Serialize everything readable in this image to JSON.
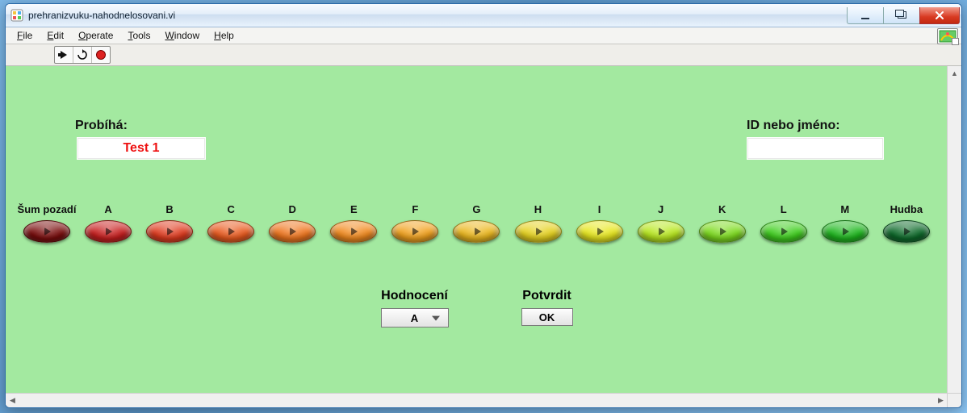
{
  "window": {
    "title": "prehranizvuku-nahodnelosovani.vi"
  },
  "menu": {
    "items": [
      {
        "label": "File",
        "hotkey": "F"
      },
      {
        "label": "Edit",
        "hotkey": "E"
      },
      {
        "label": "Operate",
        "hotkey": "O"
      },
      {
        "label": "Tools",
        "hotkey": "T"
      },
      {
        "label": "Window",
        "hotkey": "W"
      },
      {
        "label": "Help",
        "hotkey": "H"
      }
    ]
  },
  "toolbar": {
    "buttons": [
      "run-arrow",
      "run-continuous",
      "abort"
    ]
  },
  "labels": {
    "running": "Probíhá:",
    "id_name": "ID nebo jméno:",
    "rating": "Hodnocení",
    "confirm": "Potvrdit"
  },
  "running_value": "Test 1",
  "id_value": "",
  "ovals": [
    {
      "label": "Šum pozadí",
      "color": "#7a0d0d"
    },
    {
      "label": "A",
      "color": "#c81e1e"
    },
    {
      "label": "B",
      "color": "#e03a1e"
    },
    {
      "label": "C",
      "color": "#ea5a1e"
    },
    {
      "label": "D",
      "color": "#f0761e"
    },
    {
      "label": "E",
      "color": "#f28a1e"
    },
    {
      "label": "F",
      "color": "#f2a21e"
    },
    {
      "label": "G",
      "color": "#ecb81e"
    },
    {
      "label": "H",
      "color": "#e6d21e"
    },
    {
      "label": "I",
      "color": "#e8e81e"
    },
    {
      "label": "J",
      "color": "#b8e81e"
    },
    {
      "label": "K",
      "color": "#7ddc1e"
    },
    {
      "label": "L",
      "color": "#3fcf1e"
    },
    {
      "label": "M",
      "color": "#1eb81e"
    },
    {
      "label": "Hudba",
      "color": "#0d6a2a"
    }
  ],
  "rating_value": "A",
  "ok_label": "OK"
}
